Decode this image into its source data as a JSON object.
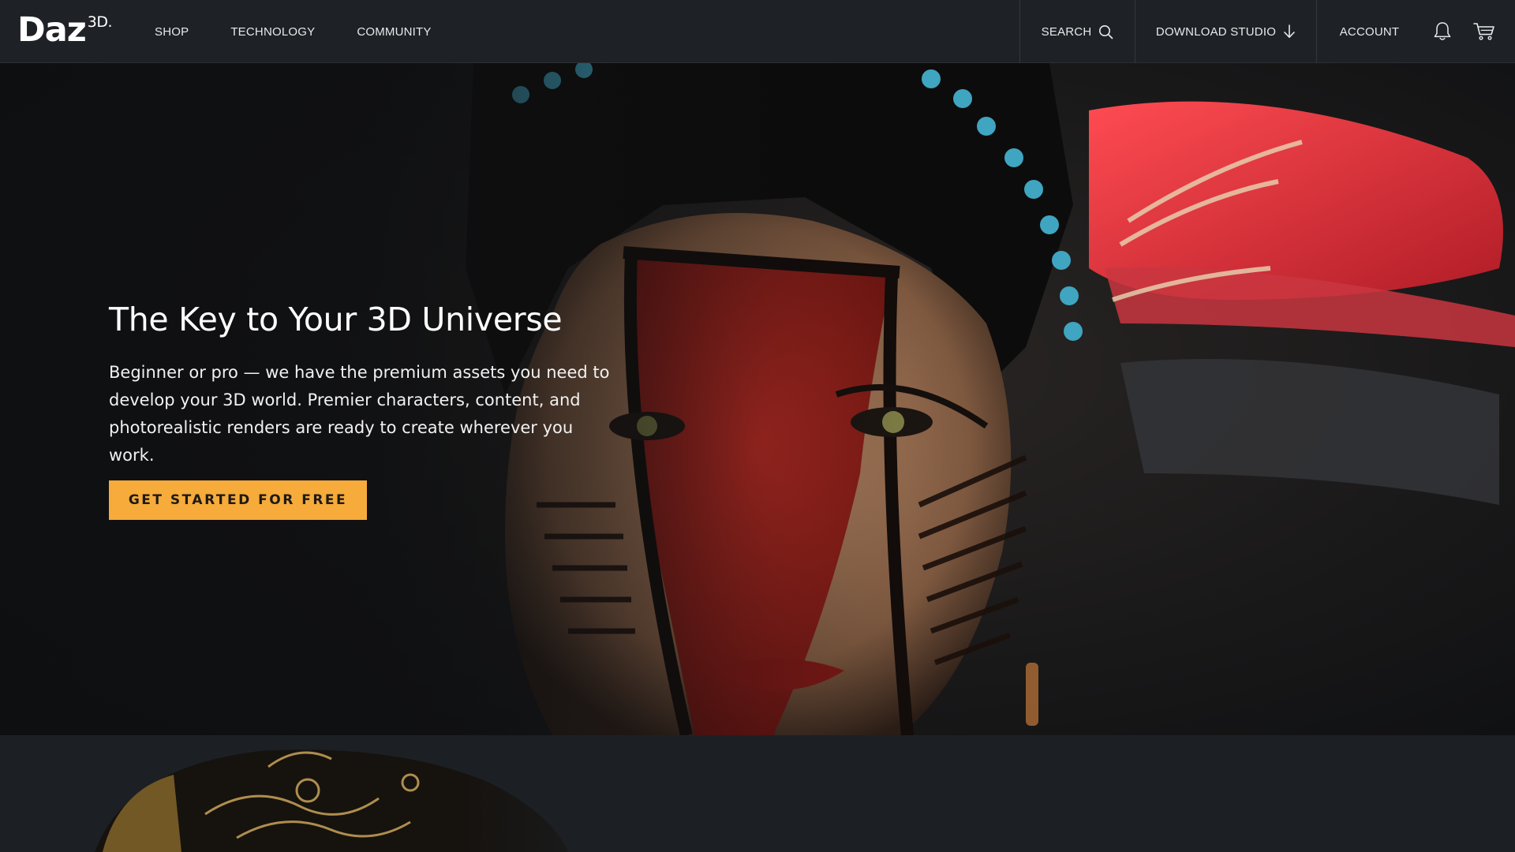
{
  "brand": {
    "name": "Daz",
    "superscript": "3D."
  },
  "nav": {
    "left": [
      {
        "label": "SHOP"
      },
      {
        "label": "TECHNOLOGY"
      },
      {
        "label": "COMMUNITY"
      }
    ],
    "search_label": "SEARCH",
    "download_label": "DOWNLOAD STUDIO",
    "account_label": "ACCOUNT",
    "icons": [
      "search-icon",
      "download-arrow-icon",
      "bell-icon",
      "cart-icon"
    ]
  },
  "hero": {
    "title": "The Key to Your 3D Universe",
    "description": "Beginner or pro — we have the premium assets you need to develop your 3D world. Premier characters, content, and photorealistic renders are ready to create wherever you work.",
    "cta_label": "GET STARTED FOR FREE",
    "image_subject": "3D rendered woman with red and black tribal face paint and feathered headdress"
  },
  "colors": {
    "header_bg": "#1e2226",
    "cta_bg": "#f6ab3a",
    "cta_text": "#1e1a14",
    "page_bg": "#1c1f23"
  }
}
